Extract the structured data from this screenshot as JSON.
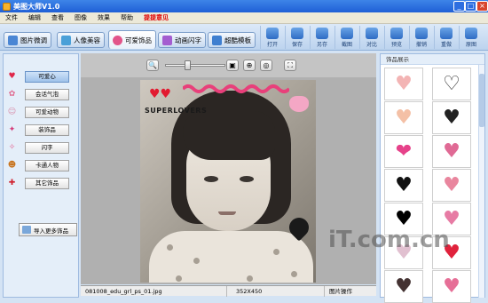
{
  "window": {
    "title": "美图大师V1.0",
    "controls": [
      "_",
      "□",
      "×"
    ]
  },
  "menu": [
    "文件",
    "编辑",
    "查看",
    "图像",
    "效果",
    "帮助",
    "提提意见"
  ],
  "tabs": [
    {
      "label": "图片微调",
      "color": "#4a86d4",
      "active": false
    },
    {
      "label": "人像美容",
      "color": "#4aa0d8",
      "active": false
    },
    {
      "label": "可爱饰品",
      "color": "#e2548a",
      "active": true
    },
    {
      "label": "动画闪字",
      "color": "#a45dd0",
      "active": false
    },
    {
      "label": "超酷模板",
      "color": "#3f7fd0",
      "active": false
    }
  ],
  "toolbar_buttons": [
    "打开",
    "保存",
    "另存",
    "截图",
    "对比",
    "预览",
    "撤销",
    "重做",
    "原图"
  ],
  "categories": [
    {
      "label": "可爱心",
      "icon": "heart-icon",
      "glyph": "♥",
      "color": "#e0284a",
      "selected": true
    },
    {
      "label": "会话气泡",
      "icon": "speech-bubble-icon",
      "glyph": "✿",
      "color": "#e06a8f",
      "selected": false
    },
    {
      "label": "可爱动物",
      "icon": "animal-icon",
      "glyph": "☺",
      "color": "#d88aa8",
      "selected": false
    },
    {
      "label": "装饰品",
      "icon": "bow-icon",
      "glyph": "✦",
      "color": "#d53c7a",
      "selected": false
    },
    {
      "label": "闪字",
      "icon": "sparkle-text-icon",
      "glyph": "✧",
      "color": "#e45a8c",
      "selected": false
    },
    {
      "label": "卡通人物",
      "icon": "cartoon-girl-icon",
      "glyph": "☻",
      "color": "#c8741e",
      "selected": false
    },
    {
      "label": "其它饰品",
      "icon": "gift-icon",
      "glyph": "✚",
      "color": "#d0202d",
      "selected": false
    }
  ],
  "more_button": "导入更多饰品",
  "zoom_controls": {
    "zoom_out": "🔍",
    "fit": "▣",
    "actual": "⊕",
    "minimap": "◎",
    "fullscreen": "⛶",
    "zoom_percent": 0.35
  },
  "photo": {
    "sticker_text": "SUPERLOVERS"
  },
  "status": {
    "filename": "081008_edu_grl_ps_01.jpg",
    "dimensions": "352X450",
    "mode": "图片操作"
  },
  "right_panel": {
    "title": "饰品展示",
    "thumbs": [
      {
        "glyph": "♥",
        "color": "#f3b4b4"
      },
      {
        "glyph": "♡",
        "color": "#333333"
      },
      {
        "glyph": "♥",
        "color": "#f4c0a6"
      },
      {
        "glyph": "♥",
        "color": "#222222"
      },
      {
        "glyph": "❤",
        "color": "#e6428a"
      },
      {
        "glyph": "♥",
        "color": "#e06a95"
      },
      {
        "glyph": "♥",
        "color": "#111111"
      },
      {
        "glyph": "♥",
        "color": "#e9869e"
      },
      {
        "glyph": "♥",
        "color": "#000000"
      },
      {
        "glyph": "♥",
        "color": "#e77ba4"
      },
      {
        "glyph": "♥",
        "color": "#e1c0d0"
      },
      {
        "glyph": "♥",
        "color": "#e0223c"
      },
      {
        "glyph": "♥",
        "color": "#443333"
      },
      {
        "glyph": "♥",
        "color": "#e66f97"
      }
    ]
  },
  "watermark": "iT.com.cn"
}
